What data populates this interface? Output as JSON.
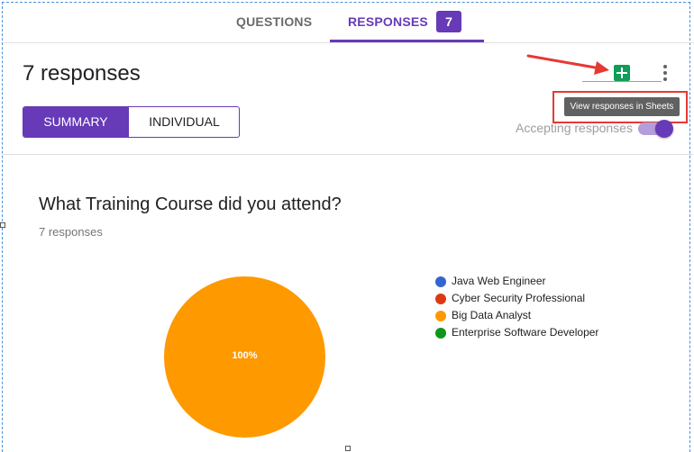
{
  "tabs": {
    "questions_label": "QUESTIONS",
    "responses_label": "RESPONSES",
    "responses_count": "7",
    "accent_color": "#673ab7"
  },
  "header": {
    "title": "7 responses",
    "summary_label": "SUMMARY",
    "individual_label": "INDIVIDUAL",
    "sheets_icon": "sheets-plus-icon",
    "more_icon": "more-vert-icon",
    "tooltip": "View responses in Sheets",
    "accepting_label": "Accepting responses",
    "accepting_on": true
  },
  "question": {
    "title": "What Training Course did you attend?",
    "count_text": "7 responses"
  },
  "chart_data": {
    "type": "pie",
    "title": "What Training Course did you attend?",
    "categories": [
      "Java Web Engineer",
      "Cyber Security Professional",
      "Big Data Analyst",
      "Enterprise Software Developer"
    ],
    "values": [
      0,
      0,
      100,
      0
    ],
    "colors": [
      "#3366cc",
      "#dc3912",
      "#ff9900",
      "#109618"
    ],
    "slice_label": "100%",
    "legend_position": "right"
  }
}
